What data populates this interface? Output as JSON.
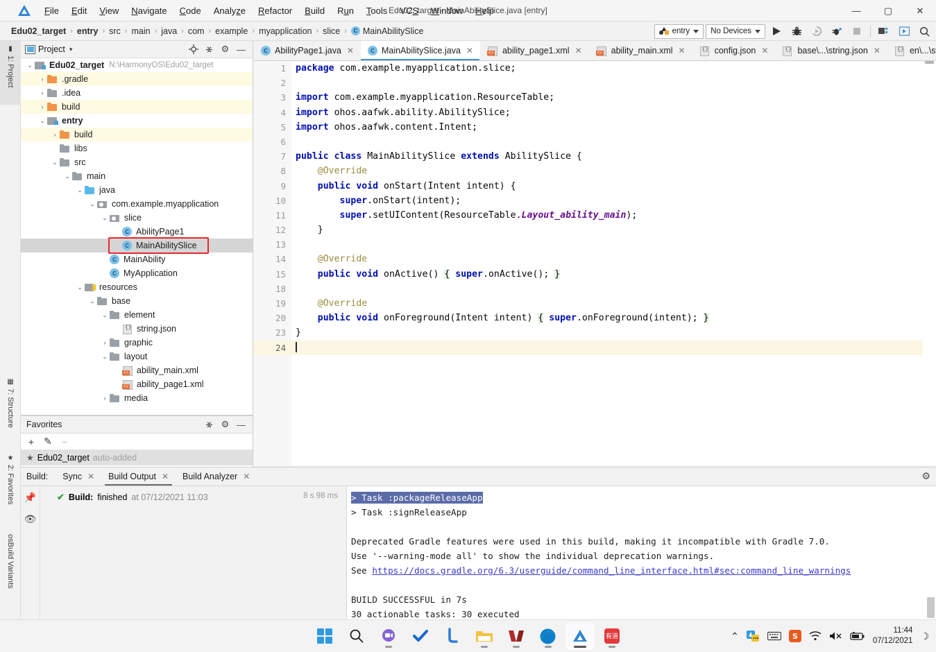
{
  "window": {
    "title": "Edu02_target - MainAbilitySlice.java [entry]",
    "minimize": "—",
    "maximize": "▢",
    "close": "✕",
    "logo_name": "deveco-studio-logo"
  },
  "menu": {
    "items": [
      "File",
      "Edit",
      "View",
      "Navigate",
      "Code",
      "Analyze",
      "Refactor",
      "Build",
      "Run",
      "Tools",
      "VCS",
      "Window",
      "Help"
    ]
  },
  "breadcrumb": {
    "items": [
      "Edu02_target",
      "entry",
      "src",
      "main",
      "java",
      "com",
      "example",
      "myapplication",
      "slice"
    ],
    "separator": "›",
    "leaf": "MainAbilitySlice",
    "leaf_icon_letter": "C"
  },
  "toolbar": {
    "run_config": "entry",
    "device": "No Devices",
    "icons": [
      "run-icon",
      "debug-icon",
      "run-coverage-icon",
      "profile-icon",
      "stop-icon",
      "device-manager-icon",
      "previewer-icon",
      "search-icon"
    ]
  },
  "left_strip": {
    "tabs": [
      "1: Project",
      "7: Structure",
      "2: Favorites",
      "osBuild Variants"
    ]
  },
  "project_panel": {
    "title": "Project",
    "dropdown_caret": "▾",
    "actions": [
      "locate-icon",
      "collapse-all-icon",
      "settings-icon",
      "hide-icon"
    ],
    "tree": [
      {
        "depth": 0,
        "label": "Edu02_target",
        "path": "N:\\HarmonyOS\\Edu02_target",
        "icon": "module",
        "twist": "⌄",
        "bold": true,
        "hl": "none"
      },
      {
        "depth": 1,
        "label": ".gradle",
        "icon": "folder-orange",
        "twist": "›",
        "hl": "yellow"
      },
      {
        "depth": 1,
        "label": ".idea",
        "icon": "folder",
        "twist": "›",
        "hl": "none"
      },
      {
        "depth": 1,
        "label": "build",
        "icon": "folder-orange",
        "twist": "›",
        "hl": "yellow"
      },
      {
        "depth": 1,
        "label": "entry",
        "icon": "module",
        "twist": "⌄",
        "bold": true,
        "hl": "none"
      },
      {
        "depth": 2,
        "label": "build",
        "icon": "folder-orange",
        "twist": "›",
        "hl": "yellow"
      },
      {
        "depth": 2,
        "label": "libs",
        "icon": "folder",
        "twist": "",
        "hl": "none"
      },
      {
        "depth": 2,
        "label": "src",
        "icon": "folder",
        "twist": "⌄",
        "hl": "none"
      },
      {
        "depth": 3,
        "label": "main",
        "icon": "folder",
        "twist": "⌄",
        "hl": "none"
      },
      {
        "depth": 4,
        "label": "java",
        "icon": "folder-blue",
        "twist": "⌄",
        "hl": "none"
      },
      {
        "depth": 5,
        "label": "com.example.myapplication",
        "icon": "pkg",
        "twist": "⌄",
        "hl": "none"
      },
      {
        "depth": 6,
        "label": "slice",
        "icon": "pkg",
        "twist": "⌄",
        "hl": "none"
      },
      {
        "depth": 7,
        "label": "AbilityPage1",
        "icon": "class",
        "twist": "",
        "hl": "none"
      },
      {
        "depth": 7,
        "label": "MainAbilitySlice",
        "icon": "class",
        "twist": "",
        "hl": "selected",
        "annotated": true
      },
      {
        "depth": 6,
        "label": "MainAbility",
        "icon": "class",
        "twist": "",
        "hl": "none"
      },
      {
        "depth": 6,
        "label": "MyApplication",
        "icon": "class",
        "twist": "",
        "hl": "none"
      },
      {
        "depth": 4,
        "label": "resources",
        "icon": "res",
        "twist": "⌄",
        "hl": "none"
      },
      {
        "depth": 5,
        "label": "base",
        "icon": "folder",
        "twist": "⌄",
        "hl": "none"
      },
      {
        "depth": 6,
        "label": "element",
        "icon": "folder",
        "twist": "⌄",
        "hl": "none"
      },
      {
        "depth": 7,
        "label": "string.json",
        "icon": "json",
        "twist": "",
        "hl": "none"
      },
      {
        "depth": 6,
        "label": "graphic",
        "icon": "folder",
        "twist": "›",
        "hl": "none"
      },
      {
        "depth": 6,
        "label": "layout",
        "icon": "folder",
        "twist": "⌄",
        "hl": "none"
      },
      {
        "depth": 7,
        "label": "ability_main.xml",
        "icon": "xml",
        "twist": "",
        "hl": "none"
      },
      {
        "depth": 7,
        "label": "ability_page1.xml",
        "icon": "xml",
        "twist": "",
        "hl": "none"
      },
      {
        "depth": 6,
        "label": "media",
        "icon": "folder",
        "twist": "›",
        "hl": "none"
      }
    ]
  },
  "favorites_panel": {
    "title": "Favorites",
    "actions": [
      "collapse-all-icon",
      "settings-icon",
      "hide-icon"
    ],
    "toolbar": [
      "+",
      "✎",
      "−"
    ],
    "row_label": "Edu02_target",
    "row_note": "auto-added"
  },
  "editor_tabs": [
    {
      "label": "AbilityPage1.java",
      "icon": "java-class-icon",
      "active": false
    },
    {
      "label": "MainAbilitySlice.java",
      "icon": "java-class-icon",
      "active": true
    },
    {
      "label": "ability_page1.xml",
      "icon": "xml-file-icon",
      "active": false
    },
    {
      "label": "ability_main.xml",
      "icon": "xml-file-icon",
      "active": false
    },
    {
      "label": "config.json",
      "icon": "json-file-icon",
      "active": false
    },
    {
      "label": "base\\...\\string.json",
      "icon": "json-file-icon",
      "active": false
    },
    {
      "label": "en\\...\\string.json",
      "icon": "json-file-icon",
      "active": false
    }
  ],
  "editor": {
    "lines": [
      {
        "num": "1",
        "html": "<span class=\"kw\">package</span> com.example.myapplication.slice;",
        "gutter": "",
        "fold": "minus-top"
      },
      {
        "num": "2",
        "html": ""
      },
      {
        "num": "3",
        "html": "<span class=\"kw\">import</span> com.example.myapplication.ResourceTable;",
        "fold": "top"
      },
      {
        "num": "4",
        "html": "<span class=\"kw\">import</span> ohos.aafwk.ability.AbilitySlice;"
      },
      {
        "num": "5",
        "html": "<span class=\"kw\">import</span> ohos.aafwk.content.Intent;",
        "fold": "bottom"
      },
      {
        "num": "6",
        "html": ""
      },
      {
        "num": "7",
        "html": "<span class=\"kw\">public class</span> MainAbilitySlice <span class=\"kw\">extends</span> AbilitySlice {"
      },
      {
        "num": "8",
        "html": "    <span class=\"ann\">@Override</span>"
      },
      {
        "num": "9",
        "html": "    <span class=\"kw\">public void</span> onStart(Intent intent) {",
        "gutter": "override",
        "fold": "minus"
      },
      {
        "num": "10",
        "html": "        <span class=\"kw\">super</span>.onStart(intent);"
      },
      {
        "num": "11",
        "html": "        <span class=\"kw\">super</span>.setUIContent(ResourceTable.<span class=\"fld\">Layout_ability_main</span>);"
      },
      {
        "num": "12",
        "html": "    }",
        "fold": "minus-end"
      },
      {
        "num": "13",
        "html": ""
      },
      {
        "num": "14",
        "html": "    <span class=\"ann\">@Override</span>"
      },
      {
        "num": "15",
        "html": "    <span class=\"kw\">public void</span> onActive() <span class=\"brc\">{</span> <span class=\"kw\">super</span>.onActive(); <span class=\"brc\">}</span>",
        "gutter": "override",
        "fold": "plus"
      },
      {
        "num": "18",
        "html": ""
      },
      {
        "num": "19",
        "html": "    <span class=\"ann\">@Override</span>"
      },
      {
        "num": "20",
        "html": "    <span class=\"kw\">public void</span> onForeground(Intent intent) <span class=\"brc\">{</span> <span class=\"kw\">super</span>.onForeground(intent); <span class=\"brc\">}</span>",
        "gutter": "override",
        "fold": "plus"
      },
      {
        "num": "23",
        "html": "}"
      },
      {
        "num": "24",
        "html": "<span class=\"caretbar\"></span>",
        "current": true
      }
    ]
  },
  "build_panel": {
    "label": "Build:",
    "tabs": [
      {
        "label": "Sync",
        "active": false
      },
      {
        "label": "Build Output",
        "active": true
      },
      {
        "label": "Build Analyzer",
        "active": false
      }
    ],
    "settings_icon": "gear-icon",
    "side_icons": [
      "pin-icon",
      "eye-icon"
    ],
    "result_status": "Build:",
    "result_text": "finished",
    "result_time": "at 07/12/2021 11:03",
    "duration": "8 s 98 ms",
    "console": [
      {
        "text": "> Task :packageReleaseApp",
        "highlight": true
      },
      {
        "text": "> Task :signReleaseApp"
      },
      {
        "text": ""
      },
      {
        "text": "Deprecated Gradle features were used in this build, making it incompatible with Gradle 7.0."
      },
      {
        "text": "Use '--warning-mode all' to show the individual deprecation warnings."
      },
      {
        "text": "See ",
        "link": "https://docs.gradle.org/6.3/userguide/command_line_interface.html#sec:command_line_warnings"
      },
      {
        "text": ""
      },
      {
        "text": "BUILD SUCCESSFUL in 7s"
      },
      {
        "text": "30 actionable tasks: 30 executed"
      }
    ]
  },
  "taskbar": {
    "items": [
      {
        "name": "start-button",
        "glyph": ""
      },
      {
        "name": "search-icon",
        "glyph": "⌕"
      },
      {
        "name": "chat-icon",
        "glyph": "▣"
      },
      {
        "name": "todo-icon",
        "glyph": "✔"
      },
      {
        "name": "linkedin-icon",
        "glyph": "L"
      },
      {
        "name": "file-explorer-icon",
        "glyph": "▰"
      },
      {
        "name": "library-icon",
        "glyph": "◣◢"
      },
      {
        "name": "edge-browser-icon",
        "glyph": "◉"
      },
      {
        "name": "deveco-studio-icon",
        "glyph": "▲"
      },
      {
        "name": "youdao-dict-icon",
        "glyph": "有道"
      }
    ],
    "tray": {
      "chevron": "⌃",
      "icons": [
        "ime-icon",
        "keyboard-icon",
        "sogou-icon",
        "wifi-icon",
        "volume-muted-icon",
        "battery-icon"
      ],
      "time": "11:44",
      "date": "07/12/2021",
      "notifications": "☽"
    }
  },
  "colors": {
    "accent": "#3f8ed0",
    "annotation_red": "#e8262c",
    "keyword_blue": "#000fb0",
    "field_purple": "#6a0f8c",
    "annotation_olive": "#9b8d3e",
    "console_highlight": "#5b6ba8",
    "link_blue": "#3a3ad0",
    "success_green": "#3c9c3c",
    "tree_yellow": "#fffbe3"
  }
}
